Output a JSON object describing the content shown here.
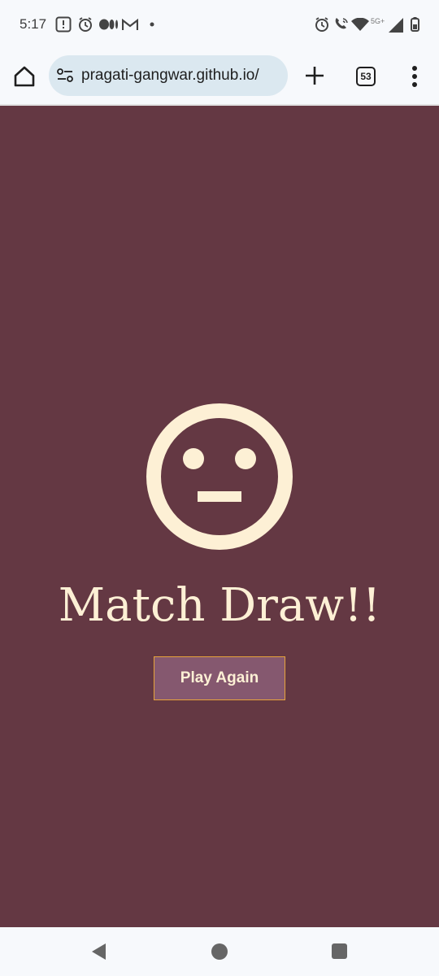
{
  "status_bar": {
    "time": "5:17",
    "network": "5G+",
    "left_icons": [
      "alert-icon",
      "alarm-icon",
      "medium-icon",
      "gmail-icon",
      "dot-icon"
    ],
    "right_icons": [
      "alarm-icon",
      "wifi-calling-icon",
      "wifi-icon",
      "signal-icon",
      "battery-icon"
    ]
  },
  "browser": {
    "url": "pragati-gangwar.github.io/",
    "tab_count": "53"
  },
  "game": {
    "result_text": "Match Draw!!",
    "play_again_label": "Play Again",
    "face_icon": "neutral-face-icon"
  },
  "colors": {
    "background": "#643843",
    "text": "#fdf0d5",
    "button_bg": "#85586f",
    "button_border": "#e7a43b"
  }
}
